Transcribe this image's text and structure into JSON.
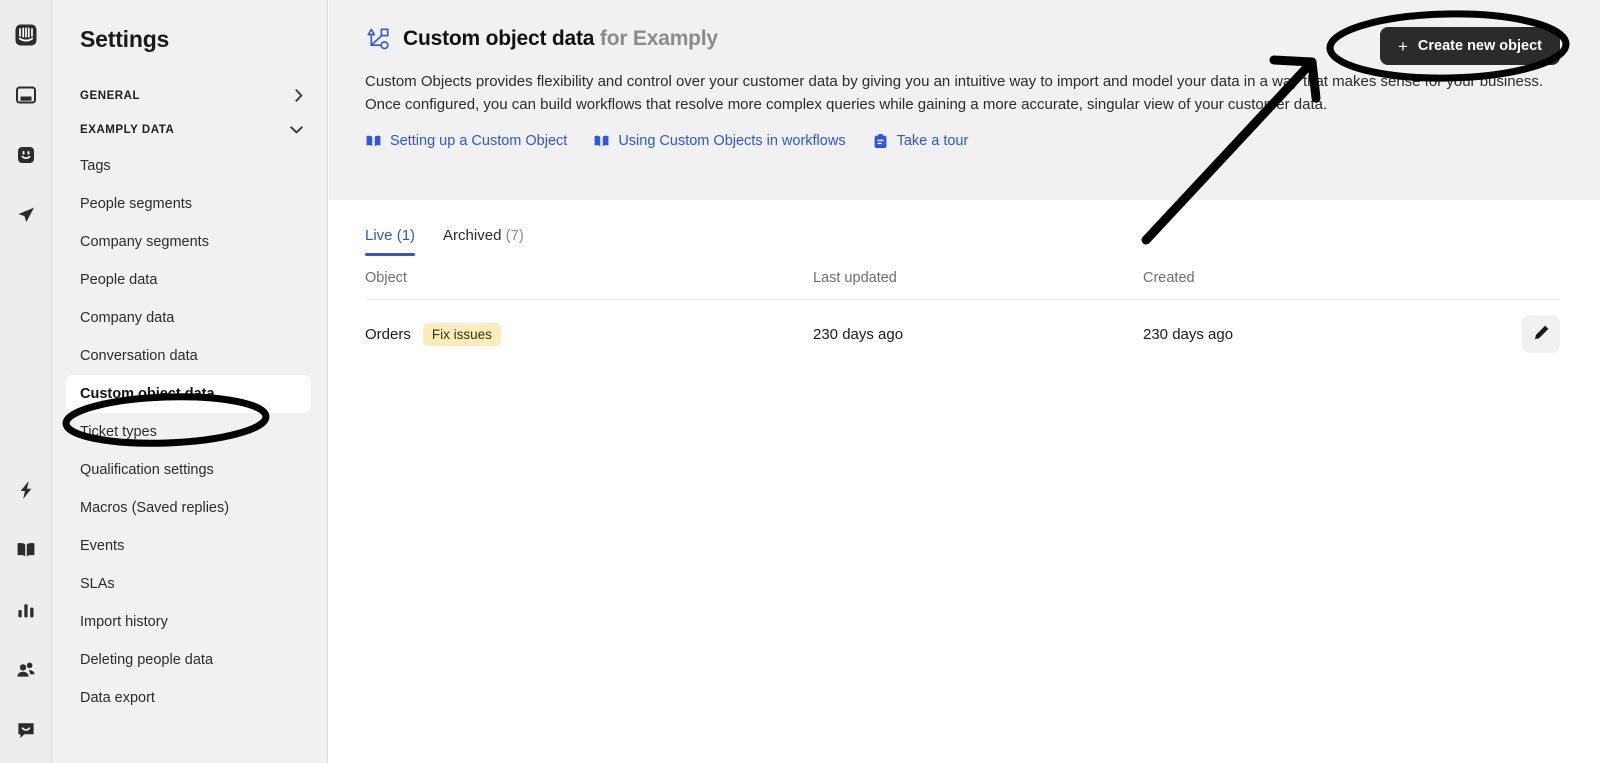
{
  "rail": {
    "top_icons": [
      {
        "name": "intercom-logo-icon",
        "label": "Intercom"
      },
      {
        "name": "inbox-icon",
        "label": "Inbox"
      },
      {
        "name": "messenger-face-icon",
        "label": "Messenger"
      },
      {
        "name": "send-outbound-icon",
        "label": "Outbound"
      }
    ],
    "bottom_icons": [
      {
        "name": "lightning-bolt-icon",
        "label": "Automation"
      },
      {
        "name": "book-icon",
        "label": "Help center"
      },
      {
        "name": "bar-chart-icon",
        "label": "Reports"
      },
      {
        "name": "people-icon",
        "label": "Contacts"
      },
      {
        "name": "chat-bubble-icon",
        "label": "Messenger preview"
      }
    ]
  },
  "sidebar": {
    "title": "Settings",
    "sections": [
      {
        "label": "GENERAL",
        "chevron": "›",
        "expanded": false
      },
      {
        "label": "EXAMPLY DATA",
        "chevron": "⌄",
        "expanded": true
      }
    ],
    "items": [
      {
        "label": "Tags",
        "selected": false
      },
      {
        "label": "People segments",
        "selected": false
      },
      {
        "label": "Company segments",
        "selected": false
      },
      {
        "label": "People data",
        "selected": false
      },
      {
        "label": "Company data",
        "selected": false
      },
      {
        "label": "Conversation data",
        "selected": false
      },
      {
        "label": "Custom object data",
        "selected": true
      },
      {
        "label": "Ticket types",
        "selected": false
      },
      {
        "label": "Qualification settings",
        "selected": false
      },
      {
        "label": "Macros (Saved replies)",
        "selected": false
      },
      {
        "label": "Events",
        "selected": false
      },
      {
        "label": "SLAs",
        "selected": false
      },
      {
        "label": "Import history",
        "selected": false
      },
      {
        "label": "Deleting people data",
        "selected": false
      },
      {
        "label": "Data export",
        "selected": false
      }
    ]
  },
  "header": {
    "icon_name": "custom-object-shapes-icon",
    "title": "Custom object data",
    "title_suffix": "for Examply",
    "description": "Custom Objects provides flexibility and control over your customer data by giving you an intuitive way to import and model your data in a way that makes sense for your business. Once configured, you can build workflows that resolve more complex queries while gaining a more accurate, singular view of your customer data.",
    "links": [
      {
        "label": "Setting up a Custom Object",
        "icon": "book-icon"
      },
      {
        "label": "Using Custom Objects in workflows",
        "icon": "book-icon"
      },
      {
        "label": "Take a tour",
        "icon": "tour-clipboard-icon"
      }
    ],
    "create_button": {
      "label": "Create new object",
      "icon": "plus-icon"
    }
  },
  "tabs": [
    {
      "label": "Live",
      "count": "(1)",
      "active": true
    },
    {
      "label": "Archived",
      "count": "(7)",
      "active": false
    }
  ],
  "table": {
    "columns": [
      "Object",
      "Last updated",
      "Created"
    ],
    "rows": [
      {
        "object": "Orders",
        "badge": "Fix issues",
        "last_updated": "230 days ago",
        "created": "230 days ago",
        "action_icon": "pencil-edit-icon"
      }
    ]
  },
  "annotations": {
    "ellipse_sidebar_target": "Custom object data",
    "ellipse_button_target": "Create new object",
    "arrow_label": "pointer-arrow"
  },
  "colors": {
    "accent_blue": "#2c55ea",
    "button_dark": "#2b2b2b",
    "badge_yellow": "#fbecb9",
    "panel_gray": "#f1f1f1",
    "rail_gray": "#eceded"
  }
}
